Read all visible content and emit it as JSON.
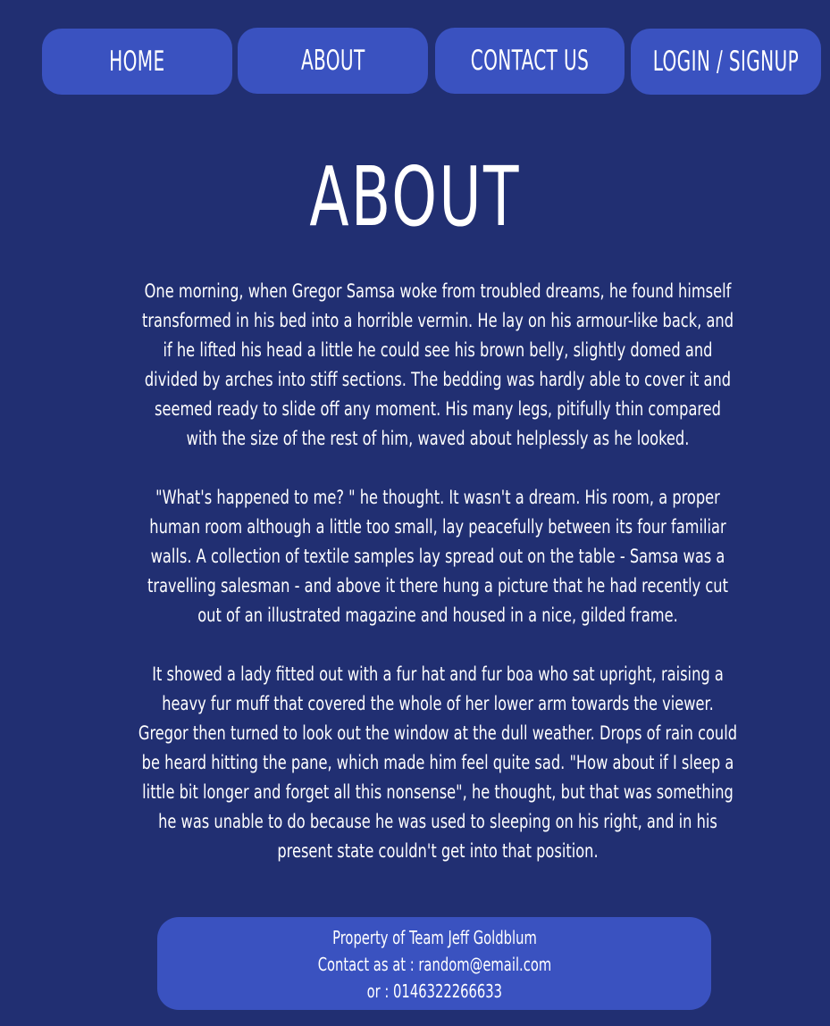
{
  "nav": {
    "home_label": "HOME",
    "about_label": "ABOUT",
    "contact_label": "CONTACT US",
    "login_label": "LOGIN / SIGNUP"
  },
  "main": {
    "title": "ABOUT",
    "paragraphs": [
      "One morning, when Gregor Samsa woke from troubled dreams, he found himself transformed in his bed into a horrible vermin. He lay on his armour-like back, and if he lifted his head a little he could see his brown belly, slightly domed and divided by arches into stiff sections. The bedding was hardly able to cover it and seemed ready to slide off any moment. His many legs, pitifully thin compared with the size of the rest of him, waved about helplessly as he looked.",
      "\"What's happened to me? \" he thought. It wasn't a dream. His room, a proper human room although a little too small, lay peacefully between its four familiar walls. A collection of textile samples lay spread out on the table - Samsa was a travelling salesman - and above it there hung a picture that he had recently cut out of an illustrated magazine and housed in a nice, gilded frame.",
      "It showed a lady fitted out with a fur hat and fur boa who sat upright, raising a heavy fur muff that covered the whole of her lower arm towards the viewer. Gregor then turned to look out the window at the dull weather. Drops of rain could be heard hitting the pane, which made him feel quite sad. \"How about if I sleep a little bit longer and forget all this nonsense\", he thought, but that was something he was unable to do because he was used to sleeping on his right, and in his present state couldn't get into that position."
    ]
  },
  "footer": {
    "line1": "Property of Team Jeff Goldblum",
    "line2": "Contact as at : random@email.com",
    "line3": "or : 0146322266633"
  },
  "colors": {
    "background": "#212f72",
    "button": "#3a52c0",
    "text": "#ffffff"
  }
}
